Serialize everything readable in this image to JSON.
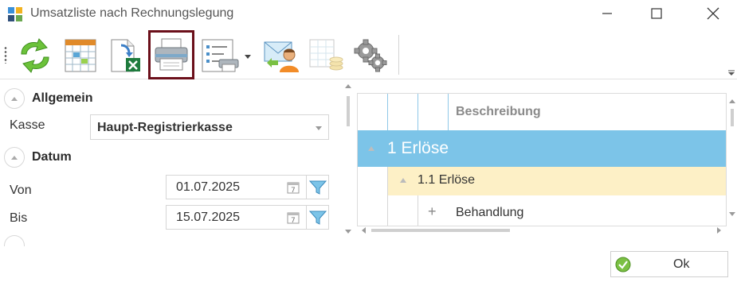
{
  "window": {
    "title": "Umsatzliste nach Rechnungslegung",
    "minimize_icon": "minimize-icon",
    "maximize_icon": "maximize-icon",
    "close_icon": "close-icon"
  },
  "toolbar": {
    "buttons": [
      {
        "name": "refresh",
        "icon": "refresh-arrows-icon"
      },
      {
        "name": "calendar-view",
        "icon": "calendar-grid-icon"
      },
      {
        "name": "export-excel",
        "icon": "excel-export-icon"
      },
      {
        "name": "print",
        "icon": "printer-icon",
        "selected": true
      },
      {
        "name": "print-list",
        "icon": "list-printer-icon",
        "has_dropdown": true
      },
      {
        "name": "email",
        "icon": "email-user-icon"
      },
      {
        "name": "table-coins",
        "icon": "table-coins-icon",
        "disabled": true
      },
      {
        "name": "settings",
        "icon": "gears-icon"
      }
    ]
  },
  "filters": {
    "sections": {
      "general": "Allgemein",
      "date": "Datum"
    },
    "kasse": {
      "label": "Kasse",
      "value": "Haupt-Registrierkasse"
    },
    "von": {
      "label": "Von",
      "value": "01.07.2025"
    },
    "bis": {
      "label": "Bis",
      "value": "15.07.2025"
    }
  },
  "grid": {
    "column_header": "Beschreibung",
    "rows": [
      {
        "level": 1,
        "label": "1 Erlöse"
      },
      {
        "level": 2,
        "label": "1.1 Erlöse"
      },
      {
        "level": 3,
        "label": "Behandlung"
      }
    ]
  },
  "footer": {
    "ok_label": "Ok"
  },
  "colors": {
    "group_level1": "#7cc4e8",
    "group_level2": "#fdf0c6",
    "selected_border": "#6b0f1a"
  }
}
